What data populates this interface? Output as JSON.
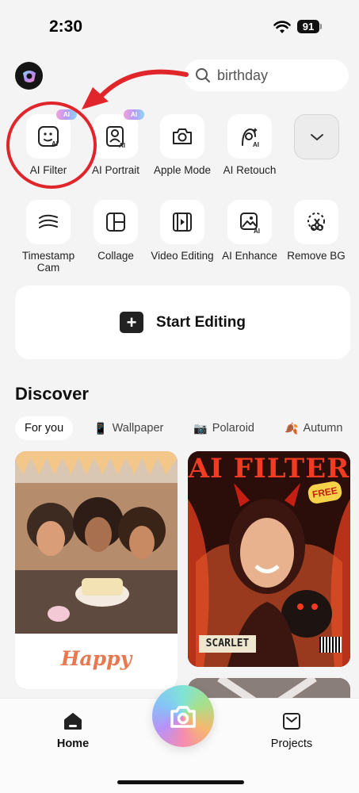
{
  "status_bar": {
    "time": "2:30",
    "battery": "91"
  },
  "search": {
    "value": "birthday"
  },
  "tools_row1": [
    {
      "label": "AI Filter",
      "icon": "ai-face-icon",
      "badge": "AI"
    },
    {
      "label": "AI Portrait",
      "icon": "ai-portrait-icon",
      "badge": "AI"
    },
    {
      "label": "Apple Mode",
      "icon": "camera-icon"
    },
    {
      "label": "AI Retouch",
      "icon": "ai-retouch-icon"
    }
  ],
  "tools_row2": [
    {
      "label": "Timestamp Cam",
      "icon": "timestamp-icon"
    },
    {
      "label": "Collage",
      "icon": "collage-icon"
    },
    {
      "label": "Video Editing",
      "icon": "video-icon"
    },
    {
      "label": "AI Enhance",
      "icon": "ai-enhance-icon"
    },
    {
      "label": "Remove BG",
      "icon": "scissors-icon"
    }
  ],
  "start_editing": {
    "label": "Start Editing"
  },
  "discover": {
    "title": "Discover",
    "chips": [
      {
        "label": "For you",
        "icon": "",
        "active": true
      },
      {
        "label": "Wallpaper",
        "icon": "📱",
        "active": false
      },
      {
        "label": "Polaroid",
        "icon": "📷",
        "active": false
      },
      {
        "label": "Autumn",
        "icon": "🍂",
        "active": false
      }
    ],
    "cards": [
      {
        "text": "Happy Birthday!"
      },
      {
        "title": "AI FILTER",
        "badge": "FREE",
        "name": "SCARLET"
      }
    ]
  },
  "tabbar": {
    "home": "Home",
    "projects": "Projects"
  },
  "colors": {
    "annotation": "#e0262b",
    "background": "#f4f4f5",
    "accent": "#222222"
  }
}
